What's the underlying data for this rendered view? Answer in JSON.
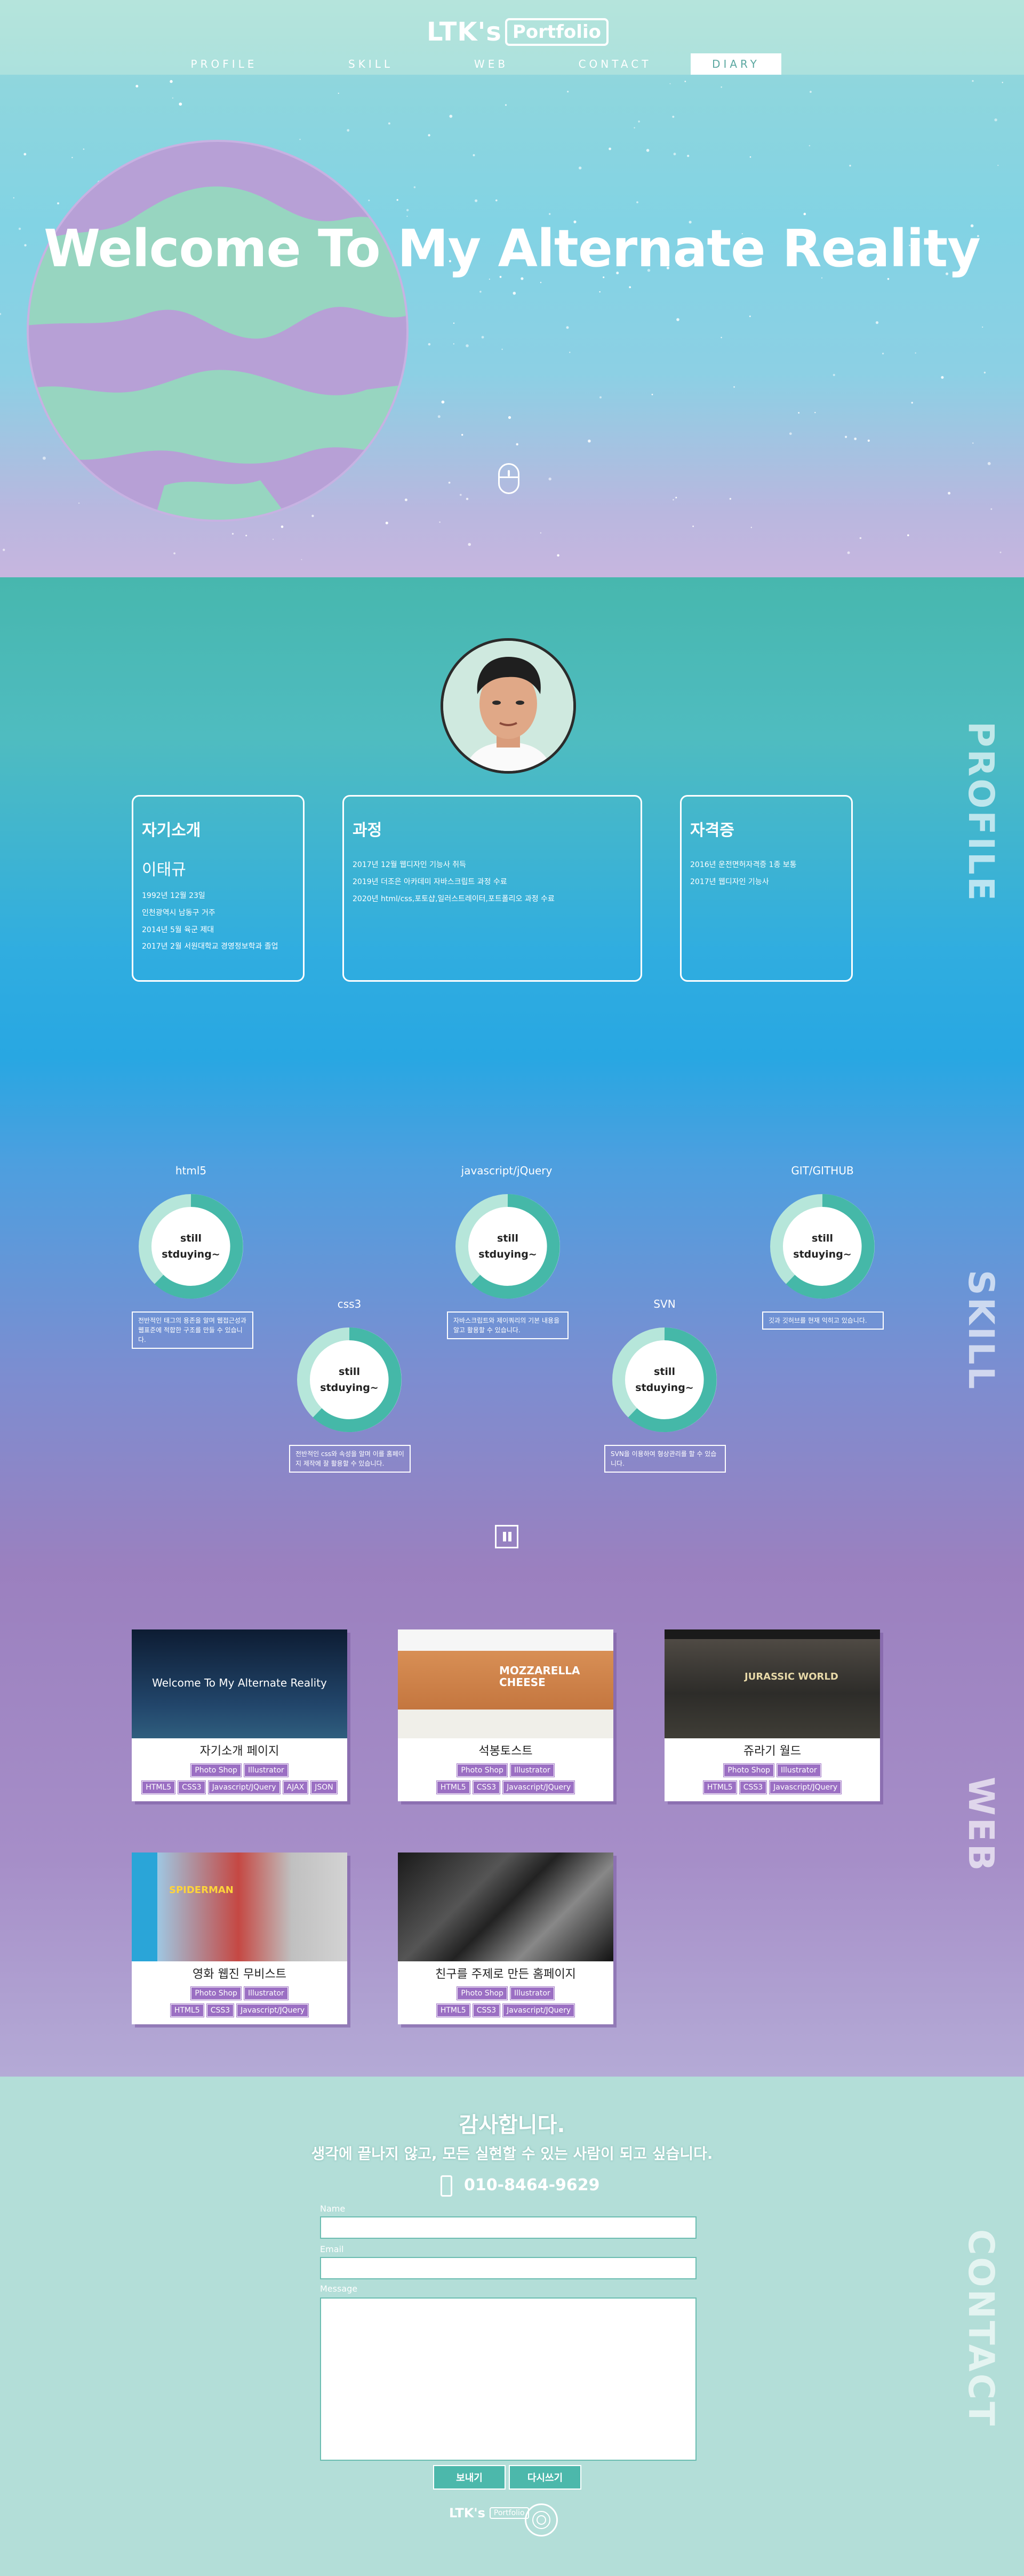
{
  "header": {
    "logo_main": "LTK's",
    "logo_box": "Portfolio",
    "nav": [
      {
        "label": "PROFILE"
      },
      {
        "label": "SKILL"
      },
      {
        "label": "WEB"
      },
      {
        "label": "CONTACT"
      },
      {
        "label": "DIARY",
        "active": true
      }
    ]
  },
  "hero": {
    "title": "Welcome To My Alternate Reality",
    "scroll_icon": "mouse-icon"
  },
  "sections": {
    "profile_label": "PROFILE",
    "skill_label": "SKILL",
    "web_label": "WEB",
    "contact_label": "CONTACT"
  },
  "profile": {
    "cards": [
      {
        "title": "자기소개",
        "name": "이태규",
        "lines": [
          "1992년 12월 23일",
          "인천광역시 남동구 거주",
          "2014년 5월 육군 제대",
          "2017년 2월 서원대학교 경영정보학과 졸업"
        ]
      },
      {
        "title": "과정",
        "lines": [
          "2017년 12월 웹디자인 기능사 취득",
          "2019년 더조은 아카데미 자바스크립트 과정 수료",
          "2020년 html/css,포토샵,일러스트레이터,포트폴리오 과정 수료"
        ]
      },
      {
        "title": "자격증",
        "lines": [
          "2016년 운전면허자격증 1종 보통",
          "2017년 웹디자인 기능사"
        ]
      }
    ]
  },
  "skills": {
    "ring_line1": "still",
    "ring_line2": "stduying~",
    "items": [
      {
        "name": "html5",
        "desc": "전반적인 태그의 용존을 알며 웹접근성과 웹표준에 적합한 구조를 만들 수 있습니다."
      },
      {
        "name": "css3",
        "desc": "전반적인 css와 속성을 알며 이를 홈페이지 제작에 잘 활용할 수 있습니다."
      },
      {
        "name": "javascript/jQuery",
        "desc": "자바스크립트와 제이쿼리의 기본 내용을 알고 활용할 수 있습니다."
      },
      {
        "name": "SVN",
        "desc": "SVN을 이용하여 형상관리를 할 수 있습니다."
      },
      {
        "name": "GIT/GITHUB",
        "desc": "깃과 깃허브를 현재 익히고 있습니다."
      }
    ]
  },
  "web": {
    "projects": [
      {
        "name": "자기소개 페이지",
        "tags_row1": [
          "Photo Shop",
          "Illustrator"
        ],
        "tags_row2": [
          "HTML5",
          "CSS3",
          "Javascript/JQuery",
          "AJAX",
          "JSON"
        ],
        "thumb_text": "Welcome To My Alternate Reality"
      },
      {
        "name": "석봉토스트",
        "tags_row1": [
          "Photo Shop",
          "Illustrator"
        ],
        "tags_row2": [
          "HTML5",
          "CSS3",
          "Javascript/JQuery"
        ],
        "thumb_text": "MOZZARELLA CHEESE"
      },
      {
        "name": "쥬라기 월드",
        "tags_row1": [
          "Photo Shop",
          "Illustrator"
        ],
        "tags_row2": [
          "HTML5",
          "CSS3",
          "Javascript/JQuery"
        ],
        "thumb_text": "JURASSIC WORLD"
      },
      {
        "name": "영화 웹진 무비스트",
        "tags_row1": [
          "Photo Shop",
          "Illustrator"
        ],
        "tags_row2": [
          "HTML5",
          "CSS3",
          "Javascript/JQuery"
        ],
        "thumb_text": "SPIDERMAN"
      },
      {
        "name": "친구를 주제로 만든 홈페이지",
        "tags_row1": [
          "Photo Shop",
          "Illustrator"
        ],
        "tags_row2": [
          "HTML5",
          "CSS3",
          "Javascript/JQuery"
        ],
        "thumb_text": ""
      }
    ]
  },
  "contact": {
    "title": "감사합니다.",
    "subtitle": "생각에 끝나지 않고, 모든 실현할 수 있는 사람이 되고 싶습니다.",
    "phone": "010-8464-9629",
    "name_label": "Name",
    "email_label": "Email",
    "message_label": "Message",
    "send_button": "보내기",
    "reset_button": "다시쓰기"
  },
  "footer": {
    "logo_main": "LTK's",
    "logo_box": "Portfolio"
  },
  "colors": {
    "accent_teal": "#4cb8ab",
    "tag_purple": "#9b6fc3",
    "ring_track": "#b6e6da",
    "ring_fill": "#45b8a8"
  }
}
